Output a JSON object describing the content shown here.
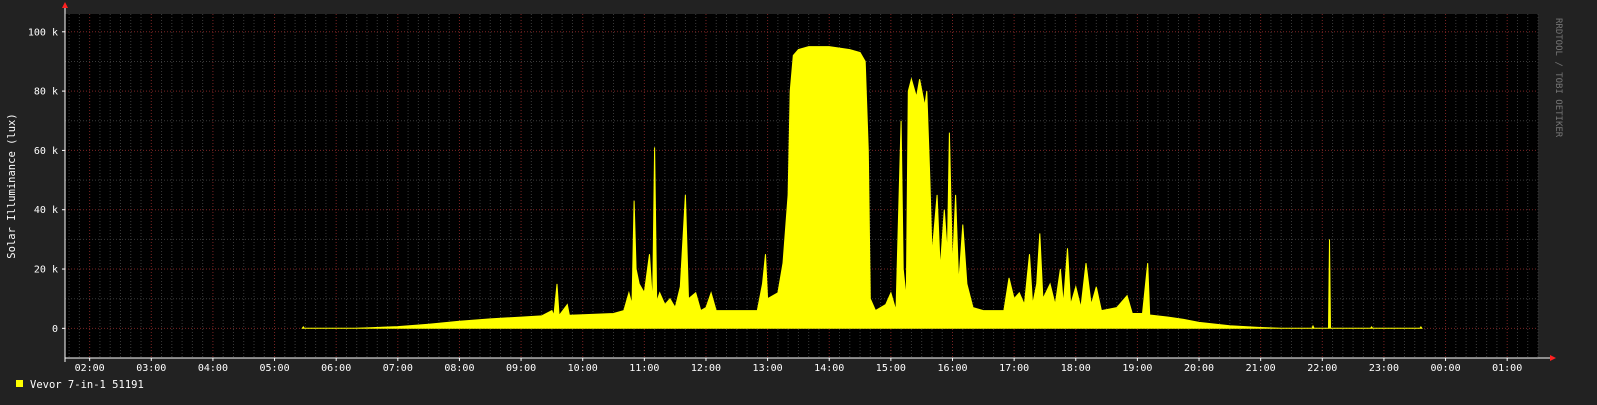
{
  "chart_data": {
    "type": "area",
    "title": "",
    "ylabel": "Solar Illuminance (lux)",
    "xlabel": "",
    "watermark": "RRDTOOL / TOBI OETIKER",
    "ylim": [
      -10000,
      106000
    ],
    "yticks": [
      {
        "value": 0,
        "label": "0"
      },
      {
        "value": 20000,
        "label": "20 k"
      },
      {
        "value": 40000,
        "label": "40 k"
      },
      {
        "value": 60000,
        "label": "60 k"
      },
      {
        "value": 80000,
        "label": "80 k"
      },
      {
        "value": 100000,
        "label": "100 k"
      }
    ],
    "x_start": "01:36",
    "x_end": "01:30",
    "xticks": [
      "02:00",
      "03:00",
      "04:00",
      "05:00",
      "06:00",
      "07:00",
      "08:00",
      "09:00",
      "10:00",
      "11:00",
      "12:00",
      "13:00",
      "14:00",
      "15:00",
      "16:00",
      "17:00",
      "18:00",
      "19:00",
      "20:00",
      "21:00",
      "22:00",
      "23:00",
      "00:00",
      "01:00"
    ],
    "grid": true,
    "legend_position": "bottom-left",
    "colors": {
      "series": "#ffff00",
      "background": "#222222",
      "plot": "#000000",
      "grid": "#3a3a3a",
      "major_grid": "#7a2424",
      "axis": "#ffffff",
      "text": "#ffffff",
      "arrow": "#ff2020"
    },
    "series": [
      {
        "name": "Vevor 7-in-1 51191",
        "color": "#ffff00",
        "points": [
          [
            "05:27",
            0
          ],
          [
            "05:28",
            500
          ],
          [
            "05:29",
            0
          ],
          [
            "06:18",
            0
          ],
          [
            "06:30",
            150
          ],
          [
            "07:00",
            600
          ],
          [
            "07:30",
            1400
          ],
          [
            "08:00",
            2400
          ],
          [
            "08:30",
            3200
          ],
          [
            "09:00",
            3800
          ],
          [
            "09:20",
            4200
          ],
          [
            "09:30",
            6000
          ],
          [
            "09:32",
            4300
          ],
          [
            "09:35",
            15000
          ],
          [
            "09:37",
            4300
          ],
          [
            "09:45",
            8000
          ],
          [
            "09:47",
            4400
          ],
          [
            "10:00",
            4600
          ],
          [
            "10:30",
            5000
          ],
          [
            "10:40",
            6000
          ],
          [
            "10:45",
            12000
          ],
          [
            "10:48",
            8000
          ],
          [
            "10:50",
            43000
          ],
          [
            "10:52",
            20000
          ],
          [
            "10:55",
            15000
          ],
          [
            "11:00",
            12000
          ],
          [
            "11:05",
            25000
          ],
          [
            "11:08",
            8000
          ],
          [
            "11:10",
            61000
          ],
          [
            "11:12",
            9000
          ],
          [
            "11:15",
            12000
          ],
          [
            "11:20",
            8000
          ],
          [
            "11:25",
            10000
          ],
          [
            "11:30",
            7000
          ],
          [
            "11:35",
            14000
          ],
          [
            "11:40",
            45000
          ],
          [
            "11:43",
            10000
          ],
          [
            "11:50",
            12000
          ],
          [
            "11:55",
            6000
          ],
          [
            "12:00",
            7000
          ],
          [
            "12:05",
            12000
          ],
          [
            "12:10",
            6000
          ],
          [
            "12:30",
            6000
          ],
          [
            "12:50",
            6000
          ],
          [
            "12:55",
            15000
          ],
          [
            "12:58",
            25000
          ],
          [
            "13:00",
            10000
          ],
          [
            "13:10",
            12000
          ],
          [
            "13:15",
            22000
          ],
          [
            "13:20",
            45000
          ],
          [
            "13:22",
            80000
          ],
          [
            "13:25",
            92000
          ],
          [
            "13:30",
            94000
          ],
          [
            "13:40",
            95000
          ],
          [
            "14:00",
            95000
          ],
          [
            "14:20",
            94000
          ],
          [
            "14:30",
            93000
          ],
          [
            "14:35",
            90000
          ],
          [
            "14:38",
            60000
          ],
          [
            "14:40",
            10000
          ],
          [
            "14:45",
            6000
          ],
          [
            "14:55",
            8000
          ],
          [
            "15:00",
            12000
          ],
          [
            "15:05",
            6000
          ],
          [
            "15:10",
            70000
          ],
          [
            "15:12",
            20000
          ],
          [
            "15:15",
            10000
          ],
          [
            "15:17",
            80000
          ],
          [
            "15:20",
            84000
          ],
          [
            "15:25",
            78000
          ],
          [
            "15:28",
            84000
          ],
          [
            "15:33",
            75000
          ],
          [
            "15:35",
            80000
          ],
          [
            "15:38",
            50000
          ],
          [
            "15:40",
            25000
          ],
          [
            "15:45",
            45000
          ],
          [
            "15:48",
            20000
          ],
          [
            "15:52",
            40000
          ],
          [
            "15:55",
            25000
          ],
          [
            "15:57",
            66000
          ],
          [
            "16:00",
            20000
          ],
          [
            "16:03",
            45000
          ],
          [
            "16:06",
            15000
          ],
          [
            "16:10",
            35000
          ],
          [
            "16:14",
            15000
          ],
          [
            "16:20",
            7000
          ],
          [
            "16:30",
            6000
          ],
          [
            "16:50",
            6000
          ],
          [
            "16:55",
            17000
          ],
          [
            "17:00",
            10000
          ],
          [
            "17:05",
            12000
          ],
          [
            "17:10",
            8000
          ],
          [
            "17:15",
            25000
          ],
          [
            "17:18",
            8000
          ],
          [
            "17:22",
            15000
          ],
          [
            "17:25",
            32000
          ],
          [
            "17:28",
            10000
          ],
          [
            "17:35",
            15000
          ],
          [
            "17:40",
            8000
          ],
          [
            "17:45",
            20000
          ],
          [
            "17:48",
            8000
          ],
          [
            "17:52",
            27000
          ],
          [
            "17:55",
            8000
          ],
          [
            "18:00",
            14000
          ],
          [
            "18:05",
            7000
          ],
          [
            "18:10",
            22000
          ],
          [
            "18:15",
            8000
          ],
          [
            "18:20",
            14000
          ],
          [
            "18:25",
            6000
          ],
          [
            "18:40",
            7000
          ],
          [
            "18:50",
            11000
          ],
          [
            "18:55",
            5000
          ],
          [
            "19:05",
            5000
          ],
          [
            "19:10",
            22000
          ],
          [
            "19:12",
            4500
          ],
          [
            "19:30",
            3800
          ],
          [
            "19:45",
            3000
          ],
          [
            "20:00",
            2000
          ],
          [
            "20:30",
            900
          ],
          [
            "21:00",
            300
          ],
          [
            "21:20",
            0
          ],
          [
            "21:50",
            0
          ],
          [
            "21:51",
            800
          ],
          [
            "21:52",
            0
          ],
          [
            "22:06",
            0
          ],
          [
            "22:07",
            30000
          ],
          [
            "22:08",
            0
          ],
          [
            "22:47",
            0
          ],
          [
            "22:48",
            500
          ],
          [
            "22:49",
            0
          ],
          [
            "23:35",
            0
          ],
          [
            "23:36",
            500
          ],
          [
            "23:37",
            0
          ]
        ]
      }
    ]
  }
}
